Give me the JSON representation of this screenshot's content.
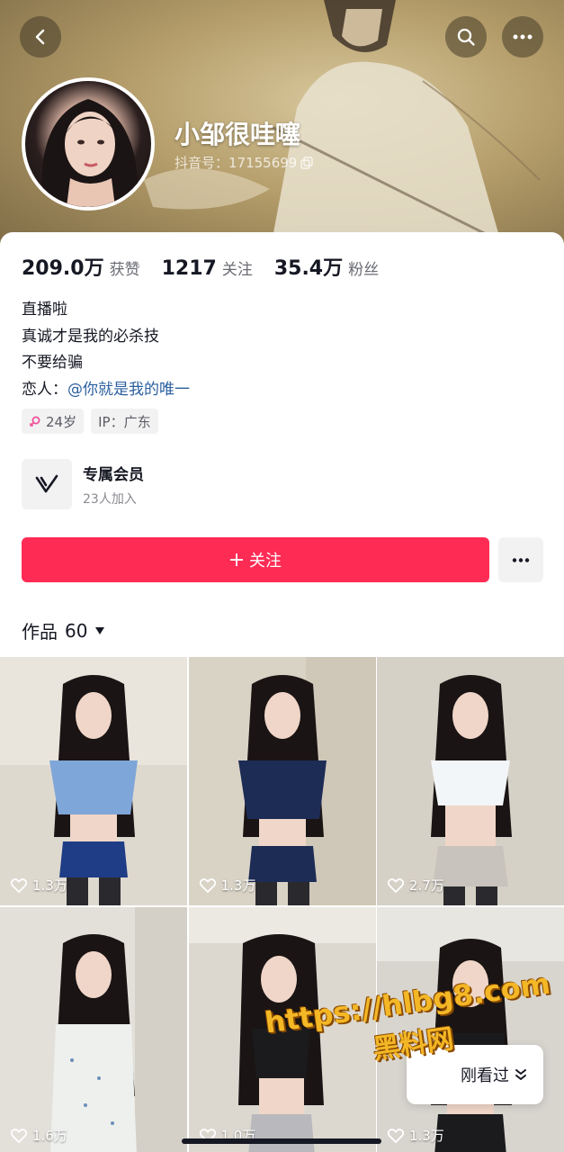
{
  "profile": {
    "nickname": "小邹很哇噻",
    "douyin_id": "抖音号：17155699"
  },
  "stats": [
    {
      "value": "209.0万",
      "label": "获赞"
    },
    {
      "value": "1217",
      "label": "关注"
    },
    {
      "value": "35.4万",
      "label": "粉丝"
    }
  ],
  "bio": {
    "line1": "直播啦",
    "line2": "真诚才是我的必杀技",
    "line3": "不要给骗",
    "lover_prefix": "恋人：",
    "lover_mention": "@你就是我的唯一"
  },
  "tags": {
    "age": "24岁",
    "ip": "IP：广东"
  },
  "membership": {
    "title": "专属会员",
    "subtitle": "23人加入"
  },
  "actions": {
    "follow_label": "关注"
  },
  "works": {
    "label": "作品",
    "count": "60"
  },
  "videos": [
    {
      "likes": "1.3万"
    },
    {
      "likes": "1.3万"
    },
    {
      "likes": "2.7万"
    },
    {
      "likes": "1.6万"
    },
    {
      "likes": "1.0万"
    },
    {
      "likes": "1.3万"
    }
  ],
  "recent": {
    "label": "刚看过"
  },
  "watermark": {
    "url": "https://hlbg8.com",
    "name": "黑料网"
  },
  "colors": {
    "accent": "#fe2c55",
    "mention": "#2b5f9e",
    "watermark": "#f4b726"
  }
}
